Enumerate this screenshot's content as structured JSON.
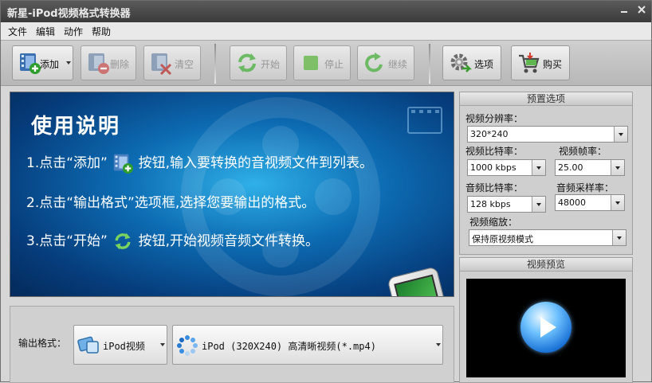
{
  "window": {
    "title": "新星-iPod视频格式转换器"
  },
  "menu": [
    "文件",
    "编辑",
    "动作",
    "帮助"
  ],
  "toolbar": {
    "add": "添加",
    "remove": "删除",
    "clear": "清空",
    "start": "开始",
    "stop": "停止",
    "resume": "继续",
    "options": "选项",
    "buy": "购买"
  },
  "banner": {
    "title": "使用说明",
    "step1_a": "1.点击“添加”",
    "step1_b": "按钮,输入要转换的音视频文件到列表。",
    "step2": "2.点击“输出格式”选项框,选择您要输出的格式。",
    "step3_a": "3.点击“开始”",
    "step3_b": "按钮,开始视频音频文件转换。"
  },
  "output": {
    "label": "输出格式：",
    "category": "iPod视频",
    "profile": "iPod (320X240) 高清晰视频(*.mp4)"
  },
  "presets": {
    "header": "预置选项",
    "resolution_label": "视频分辨率：",
    "resolution": "320*240",
    "vbitrate_label": "视频比特率：",
    "vbitrate": "1000 kbps",
    "fps_label": "视频帧率：",
    "fps": "25.00",
    "abitrate_label": "音频比特率：",
    "abitrate": "128 kbps",
    "samplerate_label": "音频采样率：",
    "samplerate": "48000",
    "scale_label": "视频缩放：",
    "scale": "保持原视频模式"
  },
  "preview": {
    "header": "视频预览"
  },
  "colors": {
    "accent": "#0d6cb3",
    "titlebar": "#4a4a4a"
  }
}
